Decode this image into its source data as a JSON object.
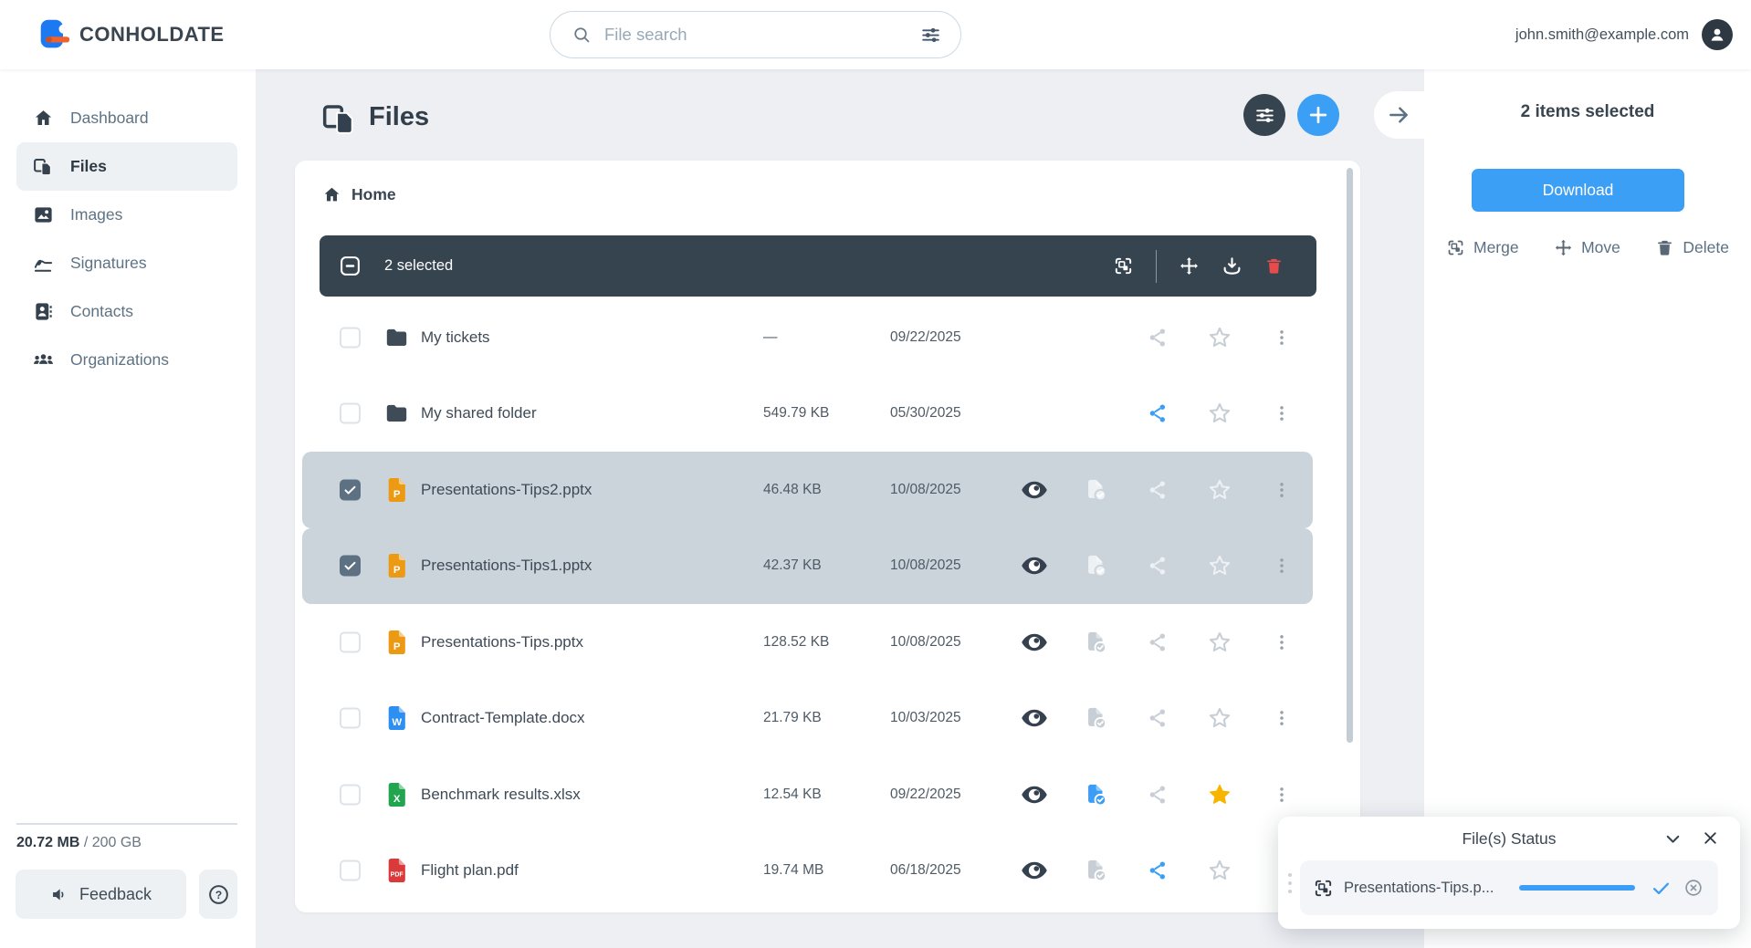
{
  "topbar": {
    "brand": "CONHOLDATE",
    "search_placeholder": "File search",
    "user_email": "john.smith@example.com"
  },
  "sidebar": {
    "items": [
      {
        "label": "Dashboard",
        "icon": "home",
        "active": false
      },
      {
        "label": "Files",
        "icon": "files",
        "active": true
      },
      {
        "label": "Images",
        "icon": "image",
        "active": false
      },
      {
        "label": "Signatures",
        "icon": "signature",
        "active": false
      },
      {
        "label": "Contacts",
        "icon": "contacts",
        "active": false
      },
      {
        "label": "Organizations",
        "icon": "people",
        "active": false
      }
    ],
    "storage_used": "20.72 MB",
    "storage_total": "/ 200 GB",
    "feedback_label": "Feedback"
  },
  "main": {
    "title": "Files",
    "breadcrumb": "Home",
    "toolbar": {
      "selected_text": "2 selected"
    },
    "files": [
      {
        "name": "My tickets",
        "type": "folder",
        "size": "—",
        "date": "09/22/2025",
        "checked": false,
        "selected": false,
        "preview": false,
        "converted": null,
        "share": "default",
        "star": "default"
      },
      {
        "name": "My shared folder",
        "type": "folder",
        "size": "549.79 KB",
        "date": "05/30/2025",
        "checked": false,
        "selected": false,
        "preview": false,
        "converted": null,
        "share": "active",
        "star": "default"
      },
      {
        "name": "Presentations-Tips2.pptx",
        "type": "pptx",
        "size": "46.48 KB",
        "date": "10/08/2025",
        "checked": true,
        "selected": true,
        "preview": true,
        "converted": "default",
        "share": "default",
        "star": "default"
      },
      {
        "name": "Presentations-Tips1.pptx",
        "type": "pptx",
        "size": "42.37 KB",
        "date": "10/08/2025",
        "checked": true,
        "selected": true,
        "preview": true,
        "converted": "default",
        "share": "default",
        "star": "default"
      },
      {
        "name": "Presentations-Tips.pptx",
        "type": "pptx",
        "size": "128.52 KB",
        "date": "10/08/2025",
        "checked": false,
        "selected": false,
        "preview": true,
        "converted": "default",
        "share": "default",
        "star": "default"
      },
      {
        "name": "Contract-Template.docx",
        "type": "docx",
        "size": "21.79 KB",
        "date": "10/03/2025",
        "checked": false,
        "selected": false,
        "preview": true,
        "converted": "default",
        "share": "default",
        "star": "default"
      },
      {
        "name": "Benchmark results.xlsx",
        "type": "xlsx",
        "size": "12.54 KB",
        "date": "09/22/2025",
        "checked": false,
        "selected": false,
        "preview": true,
        "converted": "active",
        "share": "default",
        "star": "favorite"
      },
      {
        "name": "Flight plan.pdf",
        "type": "pdf",
        "size": "19.74 MB",
        "date": "06/18/2025",
        "checked": false,
        "selected": false,
        "preview": true,
        "converted": "default",
        "share": "active",
        "star": "default"
      }
    ]
  },
  "right_panel": {
    "selected_text": "2 items selected",
    "download_label": "Download",
    "merge_label": "Merge",
    "move_label": "Move",
    "delete_label": "Delete"
  },
  "status_panel": {
    "title": "File(s) Status",
    "file_name": "Presentations-Tips.p...",
    "progress_percent": 100
  },
  "colors": {
    "accent": "#3b9ff5",
    "dark": "#364450",
    "gold": "#f7b500",
    "danger": "#e64c4c",
    "selected_row": "#cbd3db",
    "pptx": "#ec9913",
    "docx": "#2e8ff2",
    "xlsx": "#23a44f",
    "pdf": "#da3a3c"
  }
}
